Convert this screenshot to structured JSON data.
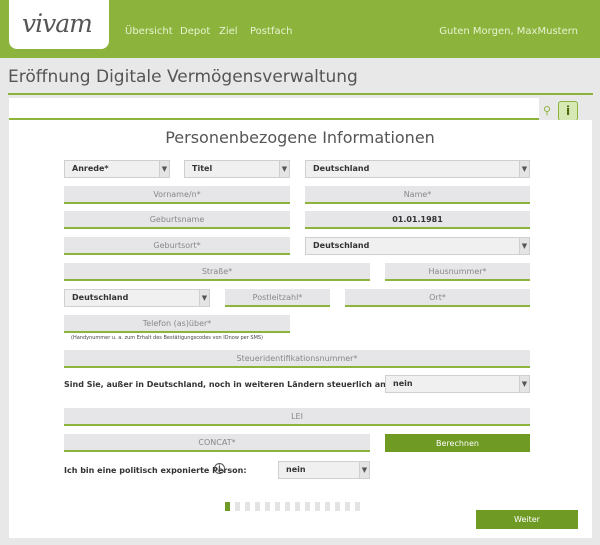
{
  "header": {
    "logo_text": "vivam",
    "nav": [
      "Übersicht",
      "Depot",
      "Ziel",
      "Postfach"
    ],
    "greeting": "Guten Morgen, MaxMustern"
  },
  "page": {
    "title": "Eröffnung Digitale Vermögensverwaltung",
    "side_icon_bulb": "lightbulb-icon",
    "side_icon_info": "info-icon"
  },
  "form": {
    "section_title": "Personenbezogene Informationen",
    "salutation": "Anrede*",
    "title": "Titel",
    "country": "Deutschland",
    "first_name_placeholder": "Vorname/n*",
    "last_name_placeholder": "Name*",
    "birth_name_placeholder": "Geburtsname",
    "birth_date": "01.01.1981",
    "birthplace_placeholder": "Geburtsort*",
    "birth_country": "Deutschland",
    "street_placeholder": "Straße*",
    "house_number_placeholder": "Hausnummer*",
    "address_country": "Deutschland",
    "postcode_placeholder": "Postleitzahl*",
    "city_placeholder": "Ort*",
    "phone_placeholder": "Telefon (as)über*",
    "phone_hint": "(Handynummer u. a. zum Erhalt des Bestätigungscodes von IDnow per SMS)",
    "tax_id_placeholder": "Steueridentifikationsnummer*",
    "tax_question": "Sind Sie, außer in Deutschland, noch in weiteren Ländern steuerlich ansässig?",
    "tax_answer": "nein",
    "lei_placeholder": "LEI",
    "concat_placeholder": "CONCAT*",
    "calc_button": "Berechnen",
    "pep_question": "Ich bin eine politisch exponierte Person:",
    "pep_answer": "nein"
  },
  "footer": {
    "progress_current": 1,
    "progress_total": 14,
    "next_button": "Weiter"
  }
}
